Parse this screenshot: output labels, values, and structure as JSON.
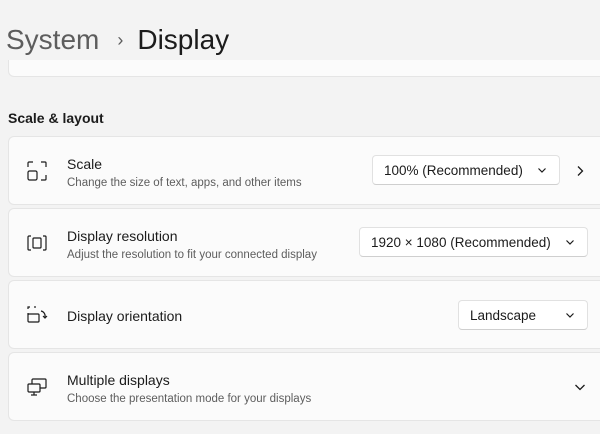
{
  "breadcrumb": {
    "parent": "System",
    "separator": "›",
    "current": "Display"
  },
  "section": {
    "title": "Scale & layout"
  },
  "cards": [
    {
      "title": "Scale",
      "subtitle": "Change the size of text, apps, and other items",
      "value": "100% (Recommended)",
      "icon": "scale-icon"
    },
    {
      "title": "Display resolution",
      "subtitle": "Adjust the resolution to fit your connected display",
      "value": "1920 × 1080 (Recommended)",
      "icon": "resolution-icon"
    },
    {
      "title": "Display orientation",
      "value": "Landscape",
      "icon": "orientation-icon"
    },
    {
      "title": "Multiple displays",
      "subtitle": "Choose the presentation mode for your displays",
      "icon": "multiple-displays-icon"
    }
  ],
  "colors": {
    "background": "#f3f3f3",
    "card": "#fbfbfb",
    "border": "#e5e5e5",
    "secondary_text": "#5d5d5d"
  }
}
